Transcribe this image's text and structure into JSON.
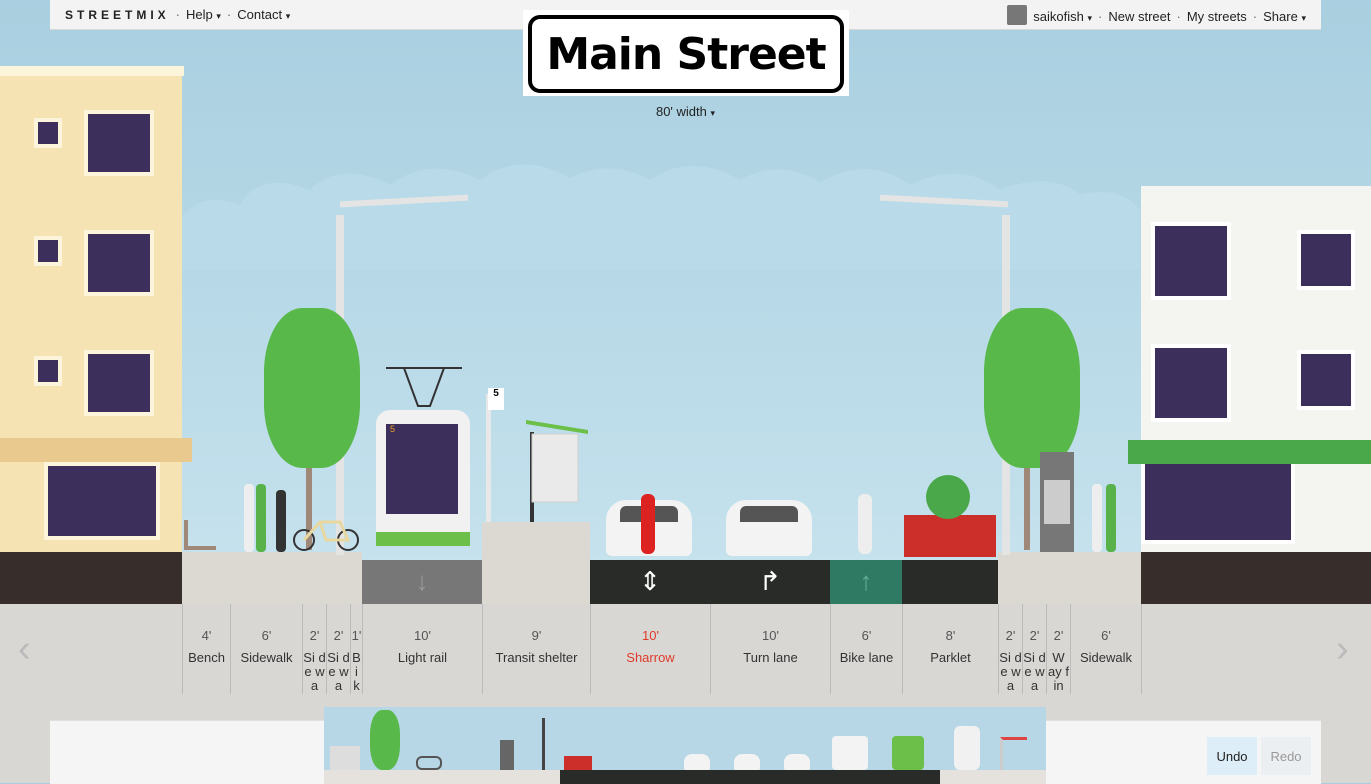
{
  "menu": {
    "logo": "STREETMIX",
    "help": "Help",
    "contact": "Contact",
    "user": "saikofish",
    "new_street": "New street",
    "my_streets": "My streets",
    "share": "Share",
    "separator": "·",
    "caret": "▾"
  },
  "street": {
    "name": "Main Street",
    "width_label": "80' width"
  },
  "segments": [
    {
      "width": "4'",
      "name": "Bench"
    },
    {
      "width": "6'",
      "name": "Sidewalk"
    },
    {
      "width": "2'",
      "name": "Si de wa"
    },
    {
      "width": "2'",
      "name": "Si de wa"
    },
    {
      "width": "1'",
      "name": "Bi k"
    },
    {
      "width": "10'",
      "name": "Light rail"
    },
    {
      "width": "9'",
      "name": "Transit shelter"
    },
    {
      "width": "10'",
      "name": "Sharrow"
    },
    {
      "width": "10'",
      "name": "Turn lane"
    },
    {
      "width": "6'",
      "name": "Bike lane"
    },
    {
      "width": "8'",
      "name": "Parklet"
    },
    {
      "width": "2'",
      "name": "Si de wa"
    },
    {
      "width": "2'",
      "name": "Si de wa"
    },
    {
      "width": "2'",
      "name": "W ay fin"
    },
    {
      "width": "6'",
      "name": "Sidewalk"
    }
  ],
  "tram_route": "5",
  "stop_sign": "5",
  "nav": {
    "left": "‹",
    "right": "›"
  },
  "lane_icons": {
    "sharrow": "⇕",
    "turn": "↱",
    "bike": "↑",
    "rail": "↓"
  },
  "history": {
    "undo": "Undo",
    "redo": "Redo"
  },
  "colors": {
    "accent": "#e03a2a",
    "lane": "#282b28",
    "bike_lane": "#2e7a62",
    "sky": "#a9cfe0"
  }
}
